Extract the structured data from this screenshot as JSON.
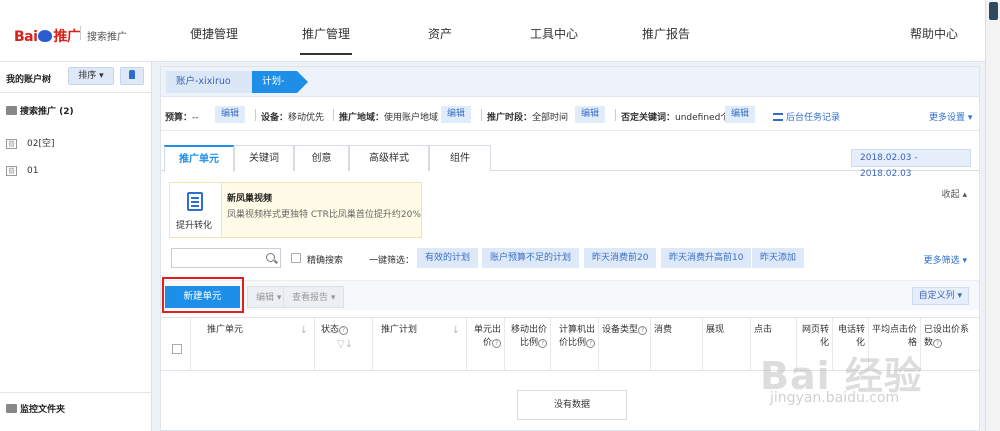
{
  "header": {
    "logo_text": "Bai百度推广",
    "logo_sub": "搜索推广",
    "nav": [
      "便捷管理",
      "推广管理",
      "资产",
      "工具中心",
      "推广报告",
      "帮助中心"
    ],
    "active_nav": "推广管理"
  },
  "sidebar": {
    "title": "我的账户树",
    "sort_label": "排序 ▾",
    "pin_label": "📌",
    "group_label": "搜索推广 (2)",
    "items": [
      {
        "badge": "普",
        "label": "02[空]"
      },
      {
        "badge": "普",
        "label": "01"
      }
    ],
    "bottom_label": "监控文件夹"
  },
  "breadcrumb": {
    "account": "账户-xixiruo",
    "plan": "计划-"
  },
  "info": {
    "budget_label": "预算：",
    "budget_value": "--",
    "edit": "编辑",
    "device_label": "设备：",
    "device_value": "移动优先",
    "region_label": "推广地域：",
    "region_value": "使用账户地域",
    "time_label": "推广时段：",
    "time_value": "全部时间",
    "negative_label": "否定关键词：",
    "negative_value": "undefined个",
    "task_log": "后台任务记录",
    "more_settings": "更多设置 ▾"
  },
  "tabs": [
    "推广单元",
    "关键词",
    "创意",
    "高级样式",
    "组件"
  ],
  "active_tab": "推广单元",
  "date_range": "2018.02.03 - 2018.02.03",
  "tip": {
    "icon_label": "提升转化",
    "title": "新凤巢视频",
    "desc": "凤巢视频样式更独特 CTR比凤巢首位提升约20%",
    "collapse": "收起 ▴"
  },
  "filters": {
    "search_placeholder": "",
    "exact_search": "精确搜索",
    "quick_label": "一键筛选：",
    "chips": [
      "有效的计划",
      "账户预算不足的计划",
      "昨天消费前20",
      "昨天消费升高前10",
      "昨天添加"
    ],
    "more_filter": "更多筛选 ▾"
  },
  "actions": {
    "new_unit": "新建单元",
    "edit": "编辑 ▾",
    "view_report": "查看报告 ▾",
    "custom_columns": "自定义列 ▾"
  },
  "table": {
    "columns": [
      "推广单元",
      "状态",
      "推广计划",
      "单元出价",
      "移动出价比例",
      "计算机出价比例",
      "设备类型",
      "消费",
      "展现",
      "点击",
      "网页转化",
      "电话转化",
      "平均点击价格",
      "已设出价系数"
    ],
    "empty_text": "没有数据"
  },
  "watermark": {
    "main": "Bai 经验",
    "sub": "jingyan.baidu.com"
  },
  "colors": {
    "accent": "#1e8fe9",
    "highlight_border": "#e02020"
  }
}
